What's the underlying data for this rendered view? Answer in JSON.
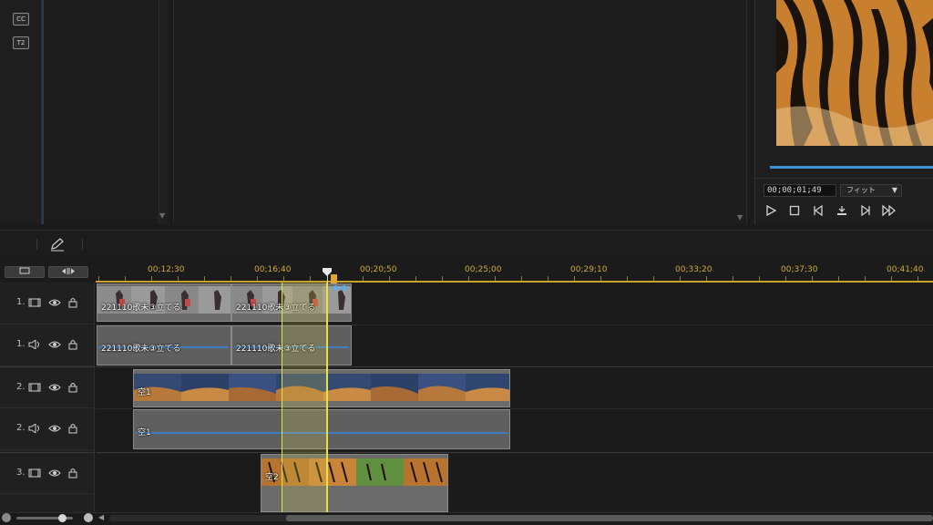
{
  "left_strip": {
    "icons": [
      {
        "name": "closed-caption-icon",
        "label": "CC"
      },
      {
        "name": "subtitle-icon",
        "label": "T2"
      }
    ]
  },
  "preview": {
    "timecode": "00;00;01;49",
    "fit_label": "フィット",
    "colors": {
      "progress": "#3d8fd6"
    }
  },
  "timeline": {
    "ruler_labels": [
      "00;12;30",
      "00;16;40",
      "00;20;50",
      "00;25;00",
      "00;29;10",
      "00;33;20",
      "00;37;30",
      "00;41;40"
    ],
    "tracks": [
      {
        "name": "1.",
        "type": "video"
      },
      {
        "name": "1.",
        "type": "audio"
      },
      {
        "name": "2.",
        "type": "video"
      },
      {
        "name": "2.",
        "type": "audio"
      },
      {
        "name": "3.",
        "type": "video"
      }
    ],
    "clips": {
      "v1a": "221110歌未③立てる",
      "v1b": "221110歌未③立てる",
      "a1a": "221110歌未③立てる",
      "a1b": "221110歌未③立てる",
      "v2": "空1",
      "a2": "空1",
      "v3": "空2"
    },
    "colors": {
      "ruler": "#c9a227",
      "playhead": "#e6e04a",
      "audio_wave": "#3e7fc4"
    }
  }
}
